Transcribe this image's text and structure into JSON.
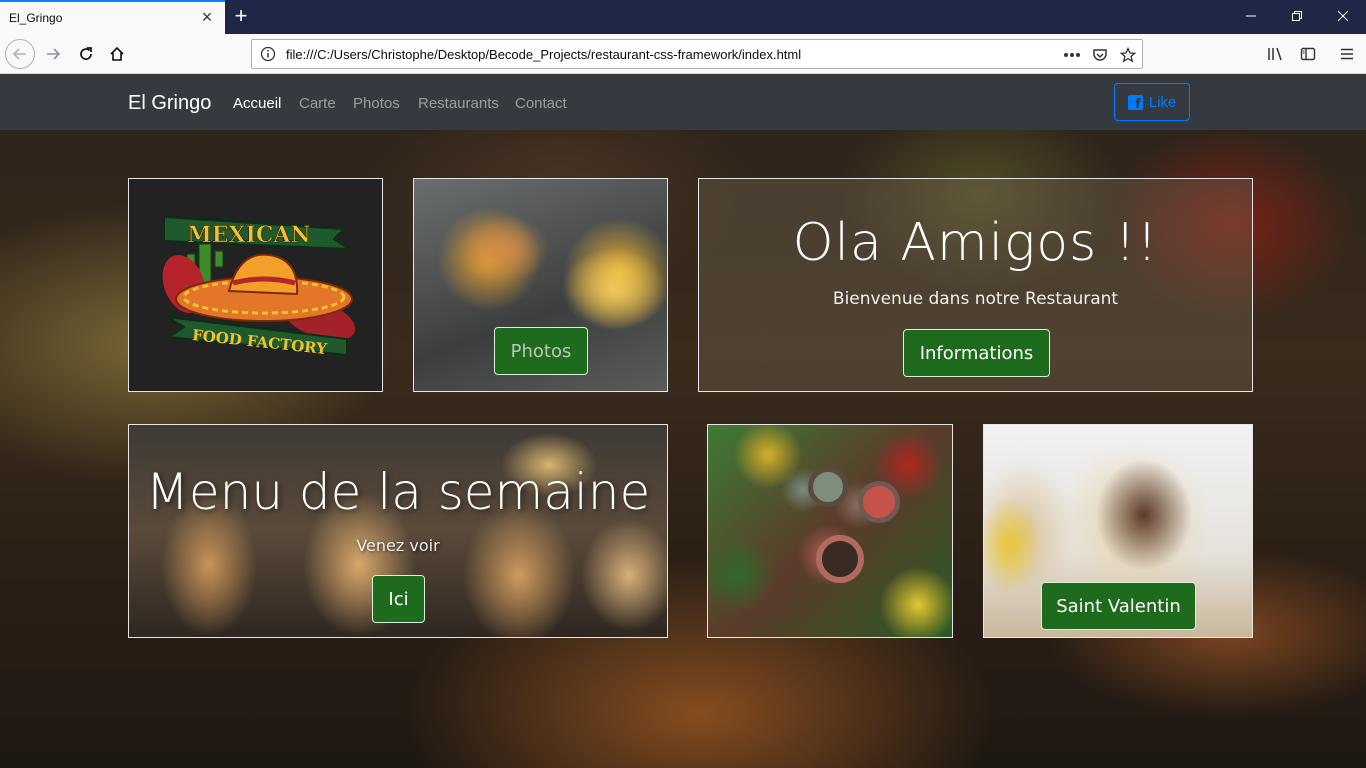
{
  "browser": {
    "tab_title": "El_Gringo",
    "url": "file:///C:/Users/Christophe/Desktop/Becode_Projects/restaurant-css-framework/index.html"
  },
  "site": {
    "brand": "El Gringo",
    "nav": [
      "Accueil",
      "Carte",
      "Photos",
      "Restaurants",
      "Contact"
    ],
    "active_nav": "Accueil",
    "like_label": "Like",
    "accent_blue": "#007bff",
    "button_green": "#1e6b1e"
  },
  "logo": {
    "line1": "MEXICAN",
    "line2": "FOOD FACTORY"
  },
  "photos_card": {
    "button": "Photos"
  },
  "welcome_card": {
    "title": "Ola Amigos !!",
    "subtitle": "Bienvenue dans notre Restaurant",
    "button": "Informations"
  },
  "menu_card": {
    "title": "Menu de la semaine",
    "subtitle": "Venez voir",
    "button": "Ici"
  },
  "tacos_card": {
    "button": "Saint Valentin"
  }
}
